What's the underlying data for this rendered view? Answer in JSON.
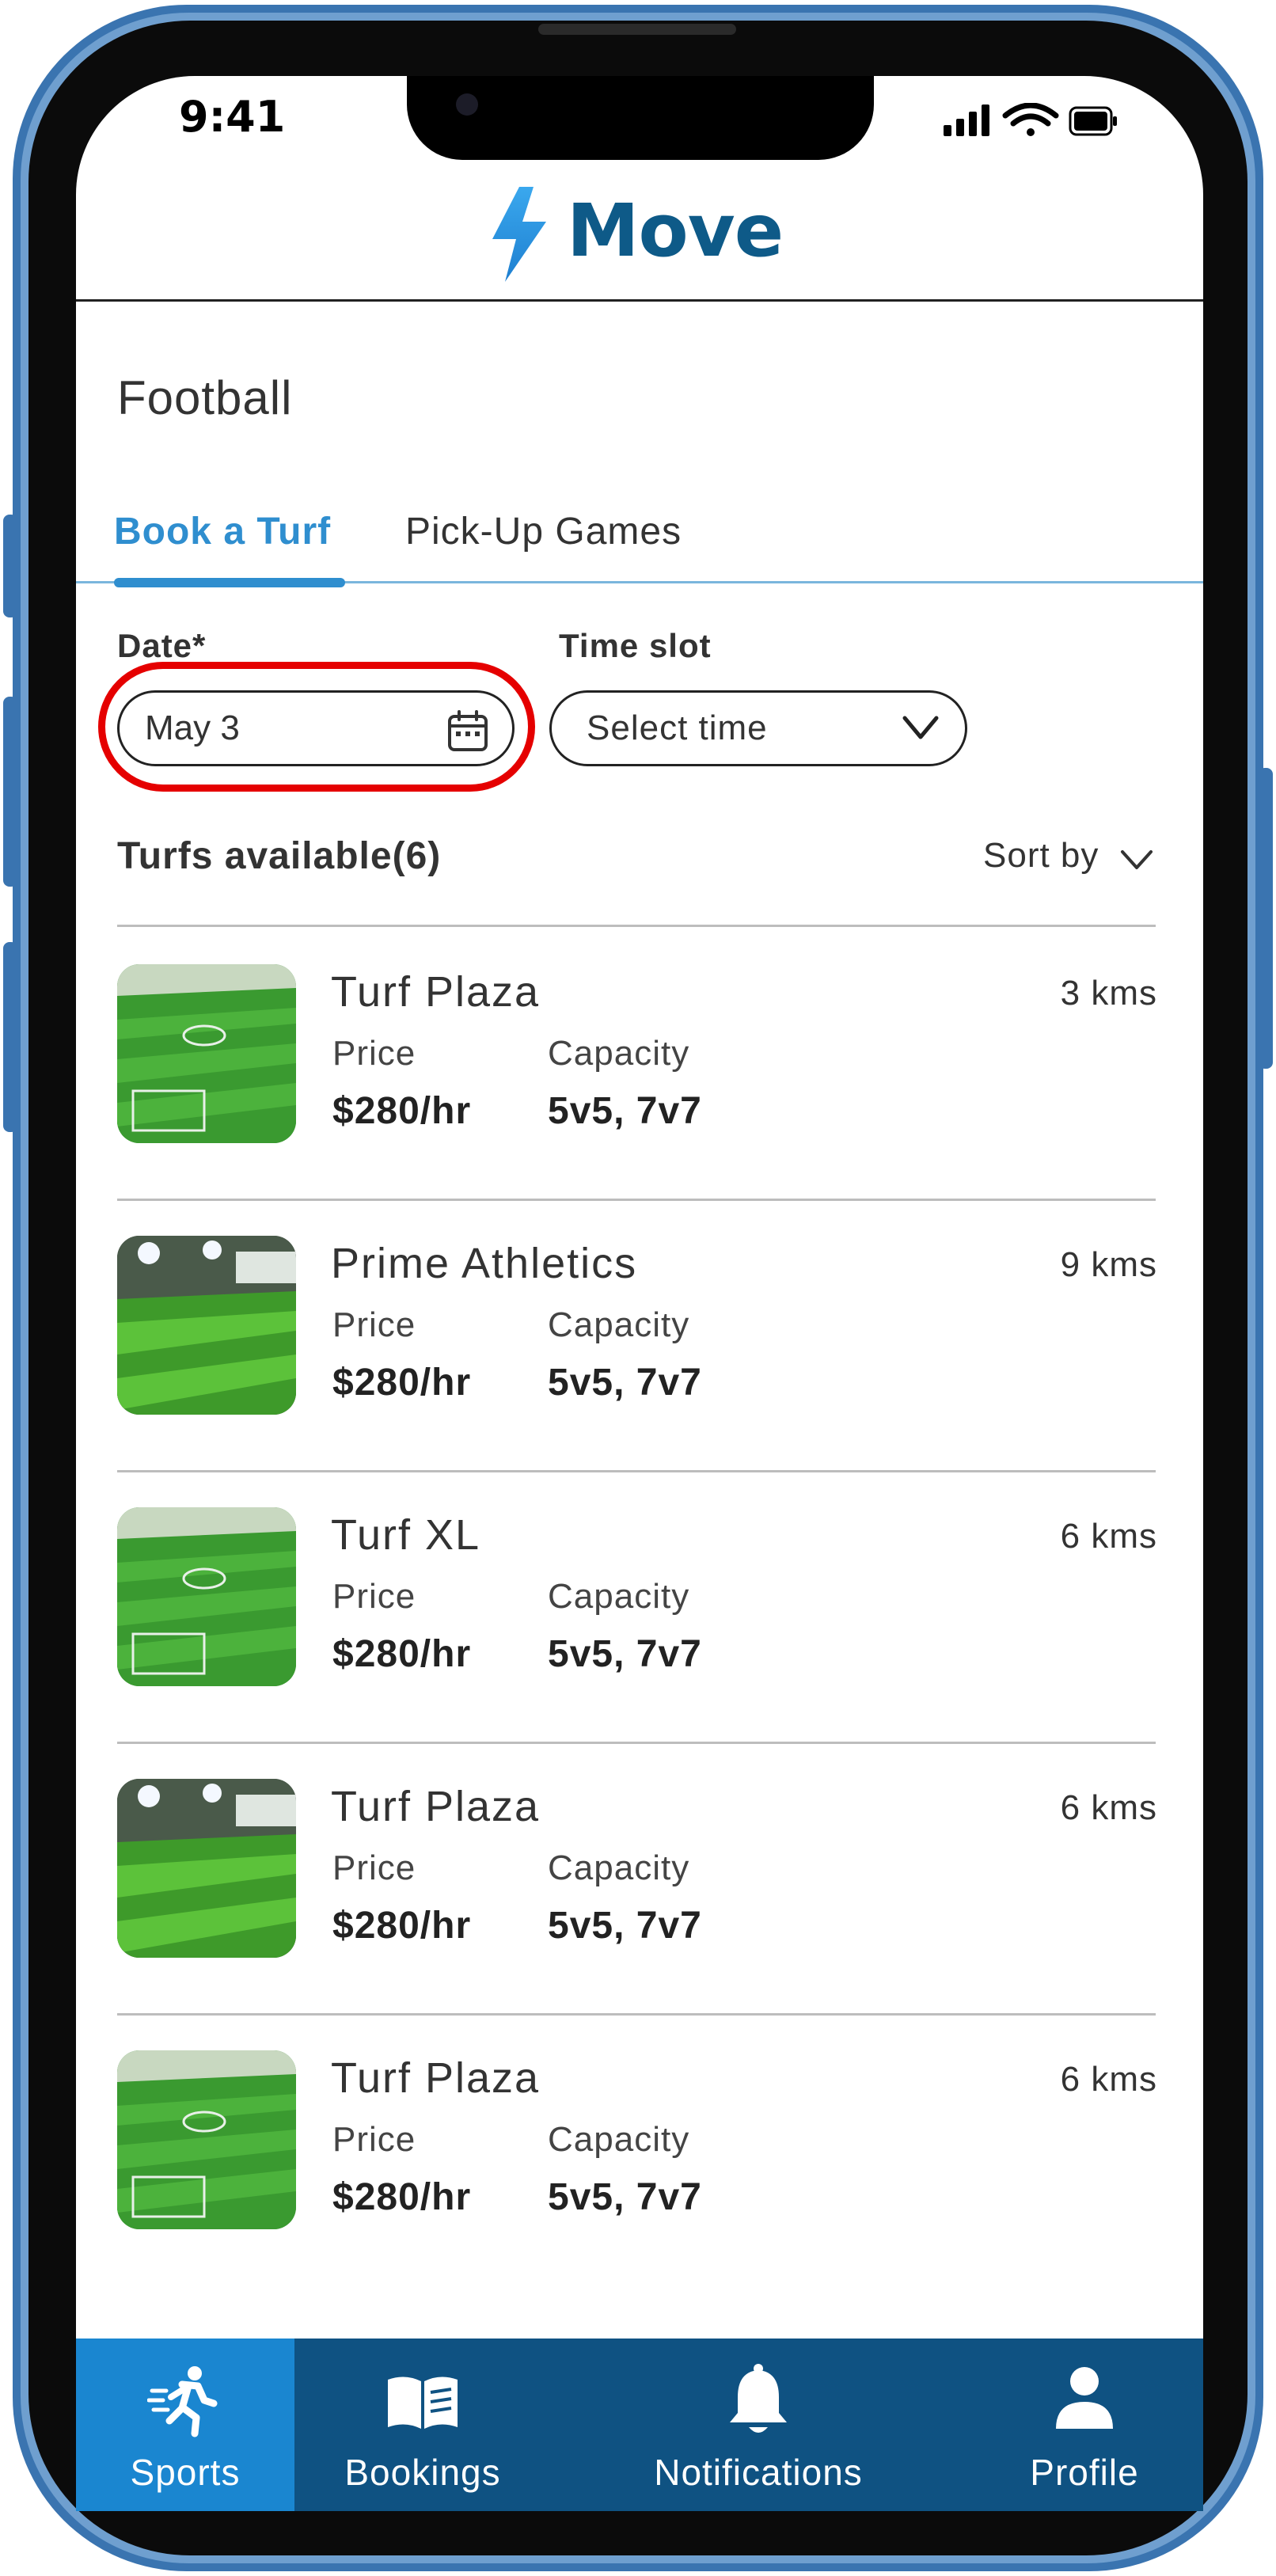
{
  "status_bar": {
    "time": "9:41"
  },
  "app": {
    "brand": "Move"
  },
  "page": {
    "title": "Football"
  },
  "tabs": [
    {
      "label": "Book a Turf",
      "active": true
    },
    {
      "label": "Pick-Up Games",
      "active": false
    }
  ],
  "filters": {
    "date_label": "Date*",
    "date_value": "May 3",
    "time_label": "Time slot",
    "time_value": "Select time"
  },
  "list_header": {
    "count_label": "Turfs available(6)",
    "sort_label": "Sort by"
  },
  "turfs": [
    {
      "name": "Turf Plaza",
      "distance": "3 kms",
      "price_label": "Price",
      "price": "$280/hr",
      "capacity_label": "Capacity",
      "capacity": "5v5, 7v7",
      "image": "daytime-turf"
    },
    {
      "name": "Prime Athletics",
      "distance": "9 kms",
      "price_label": "Price",
      "price": "$280/hr",
      "capacity_label": "Capacity",
      "capacity": "5v5, 7v7",
      "image": "night-turf"
    },
    {
      "name": "Turf XL",
      "distance": "6 kms",
      "price_label": "Price",
      "price": "$280/hr",
      "capacity_label": "Capacity",
      "capacity": "5v5, 7v7",
      "image": "daytime-turf"
    },
    {
      "name": "Turf Plaza",
      "distance": "6 kms",
      "price_label": "Price",
      "price": "$280/hr",
      "capacity_label": "Capacity",
      "capacity": "5v5, 7v7",
      "image": "night-turf"
    },
    {
      "name": "Turf Plaza",
      "distance": "6 kms",
      "price_label": "Price",
      "price": "$280/hr",
      "capacity_label": "Capacity",
      "capacity": "5v5, 7v7",
      "image": "daytime-turf"
    }
  ],
  "bottom_nav": [
    {
      "label": "Sports",
      "icon": "running-person-icon",
      "active": true
    },
    {
      "label": "Bookings",
      "icon": "book-icon",
      "active": false
    },
    {
      "label": "Notifications",
      "icon": "bell-icon",
      "active": false
    },
    {
      "label": "Profile",
      "icon": "person-icon",
      "active": false
    }
  ],
  "colors": {
    "accent": "#2f8ecf",
    "brand": "#0e5a88",
    "nav_bg": "#0f5282",
    "nav_active": "#1a86d0",
    "highlight": "#e50000",
    "frame": "#3a74b0"
  }
}
